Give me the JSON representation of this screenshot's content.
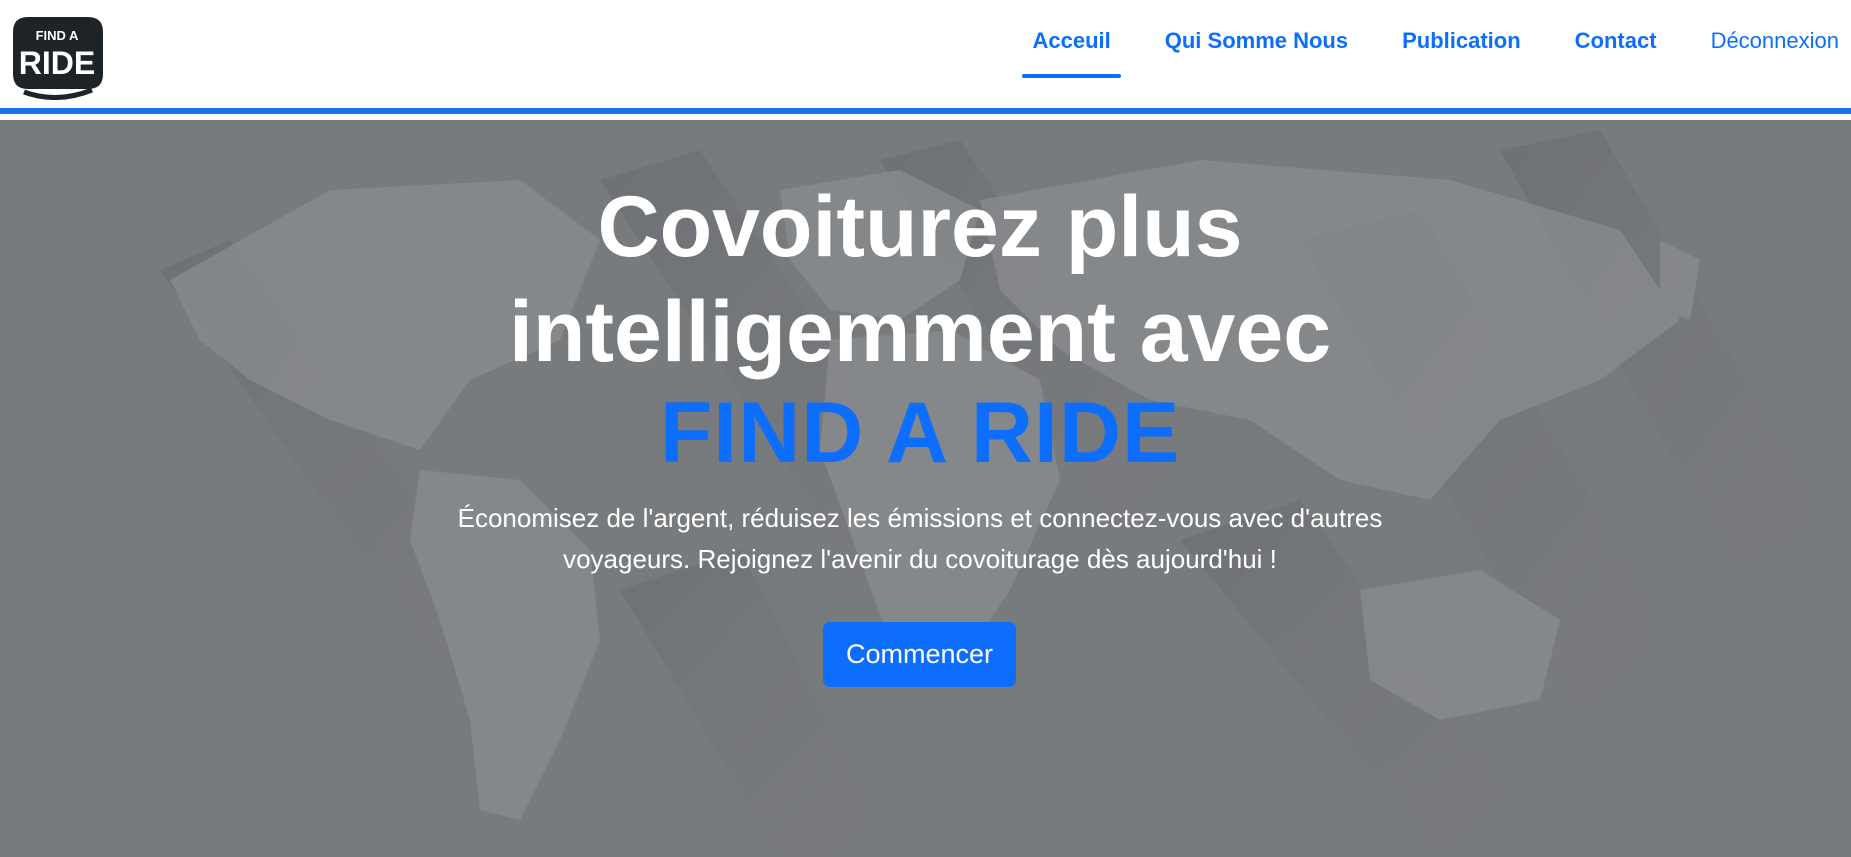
{
  "brand": {
    "logo_top_text": "FIND A",
    "logo_main_text": "RIDE"
  },
  "nav": {
    "items": [
      {
        "label": "Acceuil",
        "active": true
      },
      {
        "label": "Qui Somme Nous",
        "active": false
      },
      {
        "label": "Publication",
        "active": false
      },
      {
        "label": "Contact",
        "active": false
      },
      {
        "label": "Déconnexion",
        "active": false
      }
    ]
  },
  "hero": {
    "title_line1": "Covoiturez plus",
    "title_line2": "intelligemment avec",
    "brand_text": "FIND A RIDE",
    "subtitle_line1": "Économisez de l'argent, réduisez les émissions et connectez-vous avec d'autres",
    "subtitle_line2": "voyageurs. Rejoignez l'avenir du covoiturage dès aujourd'hui !",
    "cta_label": "Commencer"
  },
  "colors": {
    "accent": "#0d6efd",
    "hero_overlay": "#7d7f82",
    "white": "#ffffff"
  }
}
